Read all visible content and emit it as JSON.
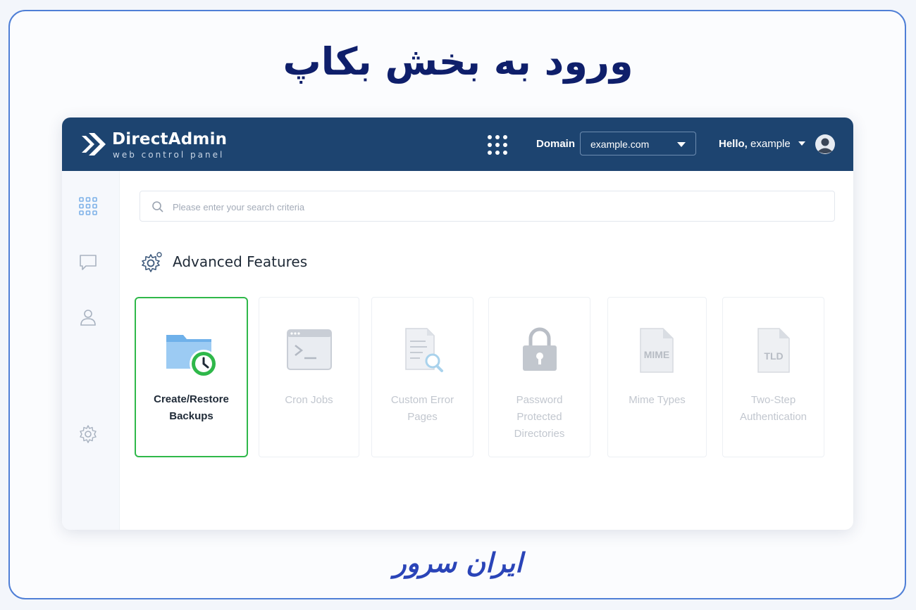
{
  "headline": "ورود به بخش بکاپ",
  "brand": "ایران سرور",
  "colors": {
    "topbar": "#1d4470",
    "accent_active": "#2fb84a",
    "headline": "#0f1f6b",
    "brand": "#2a44b8"
  },
  "topbar": {
    "logo_name": "DirectAdmin",
    "logo_subtitle": "web control panel",
    "apps_icon": "grid-dots-icon",
    "domain_label": "Domain",
    "domain_value": "example.com",
    "hello_label": "Hello,",
    "username": "example",
    "avatar_icon": "user-avatar-icon"
  },
  "sidebar": {
    "items": [
      {
        "icon": "grid-icon"
      },
      {
        "icon": "chat-icon"
      },
      {
        "icon": "user-icon"
      },
      {
        "icon": "settings-icon"
      }
    ]
  },
  "search": {
    "placeholder": "Please enter your search criteria"
  },
  "section": {
    "title": "Advanced Features",
    "icon": "gear-icon"
  },
  "cards": [
    {
      "label": "Create/Restore Backups",
      "icon": "backup-folder-icon",
      "active": true
    },
    {
      "label": "Cron Jobs",
      "icon": "terminal-window-icon",
      "active": false
    },
    {
      "label": "Custom Error Pages",
      "icon": "document-search-icon",
      "active": false
    },
    {
      "label": "Password Protected Directories",
      "icon": "padlock-icon",
      "active": false
    },
    {
      "label": "Mime Types",
      "icon": "mime-file-icon",
      "active": false,
      "icon_text": "MIME"
    },
    {
      "label": "Two-Step Authentication",
      "icon": "tld-file-icon",
      "active": false,
      "icon_text": "TLD"
    }
  ]
}
